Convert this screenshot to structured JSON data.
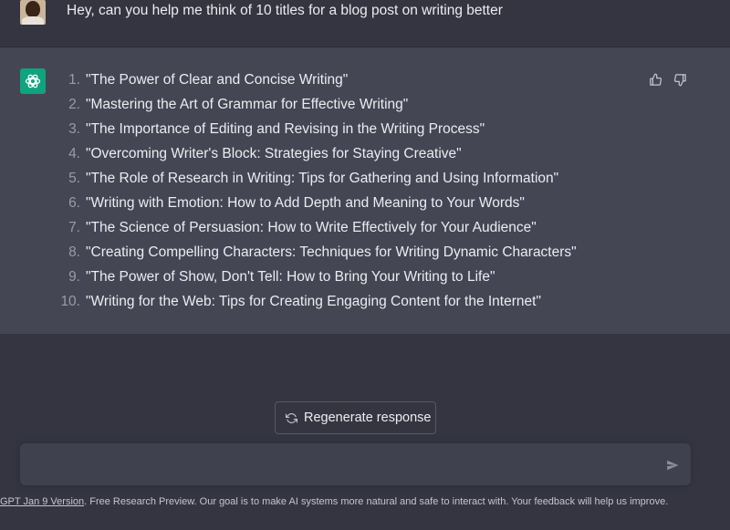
{
  "user_message": {
    "text": "Hey, can you help me think of 10 titles for a blog post on writing better"
  },
  "assistant_message": {
    "items": [
      {
        "num": "1.",
        "text": "\"The Power of Clear and Concise Writing\""
      },
      {
        "num": "2.",
        "text": "\"Mastering the Art of Grammar for Effective Writing\""
      },
      {
        "num": "3.",
        "text": "\"The Importance of Editing and Revising in the Writing Process\""
      },
      {
        "num": "4.",
        "text": "\"Overcoming Writer's Block: Strategies for Staying Creative\""
      },
      {
        "num": "5.",
        "text": "\"The Role of Research in Writing: Tips for Gathering and Using Information\""
      },
      {
        "num": "6.",
        "text": "\"Writing with Emotion: How to Add Depth and Meaning to Your Words\""
      },
      {
        "num": "7.",
        "text": "\"The Science of Persuasion: How to Write Effectively for Your Audience\""
      },
      {
        "num": "8.",
        "text": "\"Creating Compelling Characters: Techniques for Writing Dynamic Characters\""
      },
      {
        "num": "9.",
        "text": "\"The Power of Show, Don't Tell: How to Bring Your Writing to Life\""
      },
      {
        "num": "10.",
        "text": "\"Writing for the Web: Tips for Creating Engaging Content for the Internet\""
      }
    ]
  },
  "regenerate": {
    "label": "Regenerate response"
  },
  "composer": {
    "value": ""
  },
  "footer": {
    "version_link": "GPT Jan 9 Version",
    "text": ". Free Research Preview. Our goal is to make AI systems more natural and safe to interact with. Your feedback will help us improve."
  },
  "icons": {
    "bot": "openai-logo-icon",
    "thumb_up": "thumbs-up-icon",
    "thumb_down": "thumbs-down-icon",
    "regenerate": "refresh-icon",
    "send": "send-icon"
  },
  "colors": {
    "background": "#343541",
    "assistant_bg": "#444654",
    "bot_icon_bg": "#10a37f",
    "composer_bg": "#40414f"
  }
}
